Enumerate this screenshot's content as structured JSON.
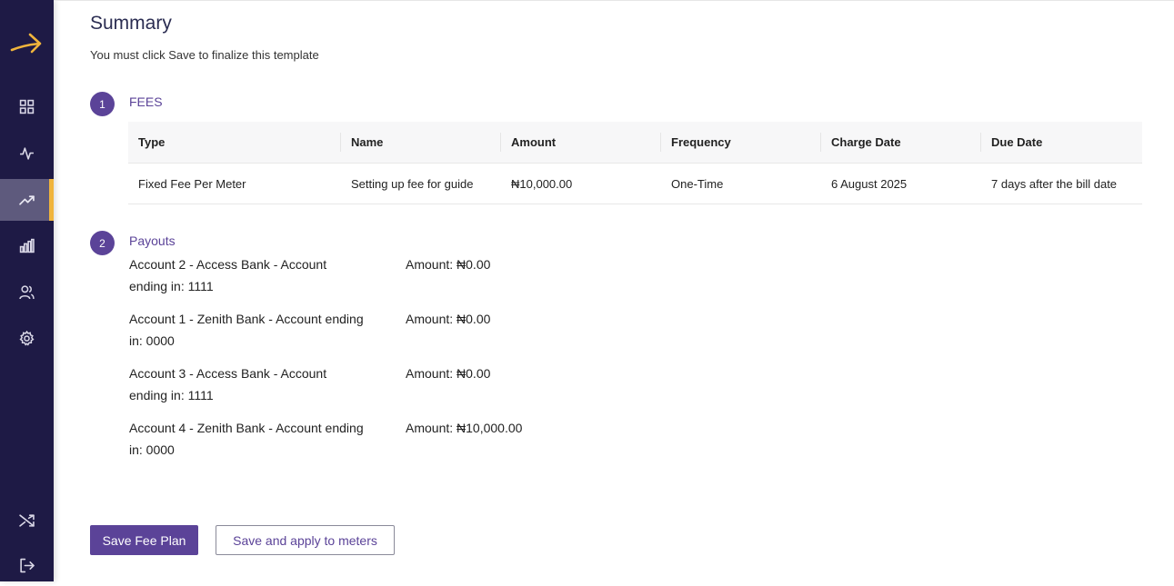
{
  "nav": {
    "items": [
      {
        "icon": "dashboard-grid-icon"
      },
      {
        "icon": "activity-pulse-icon"
      },
      {
        "icon": "trending-up-icon",
        "active": true
      },
      {
        "icon": "bar-chart-icon"
      },
      {
        "icon": "users-icon"
      },
      {
        "icon": "settings-gear-icon"
      }
    ],
    "bottom": [
      {
        "icon": "shuffle-icon"
      },
      {
        "icon": "logout-icon"
      }
    ],
    "accent": "#f0b43c",
    "background": "#1e1a45"
  },
  "page": {
    "title": "Summary",
    "subtitle": "You must click Save to finalize this template"
  },
  "fees": {
    "step": "1",
    "label": "FEES",
    "columns": [
      "Type",
      "Name",
      "Amount",
      "Frequency",
      "Charge Date",
      "Due Date"
    ],
    "rows": [
      [
        "Fixed Fee Per Meter",
        "Setting up fee for guide",
        "₦10,000.00",
        "One-Time",
        "6 August 2025",
        "7 days after the bill date"
      ]
    ]
  },
  "payouts": {
    "step": "2",
    "label": "Payouts",
    "items": [
      {
        "account": "Account 2 - Access Bank - Account ending in: 1111",
        "amount": "Amount: ₦0.00"
      },
      {
        "account": "Account 1 - Zenith Bank - Account ending in: 0000",
        "amount": "Amount: ₦0.00"
      },
      {
        "account": "Account 3 - Access Bank - Account ending in: 1111",
        "amount": "Amount: ₦0.00"
      },
      {
        "account": "Account 4 - Zenith Bank - Account ending in: 0000",
        "amount": "Amount: ₦10,000.00"
      }
    ]
  },
  "actions": {
    "save_label": "Save Fee Plan",
    "save_apply_label": "Save and apply to meters"
  },
  "colors": {
    "primary": "#5b4398",
    "title": "#2b2d52"
  }
}
